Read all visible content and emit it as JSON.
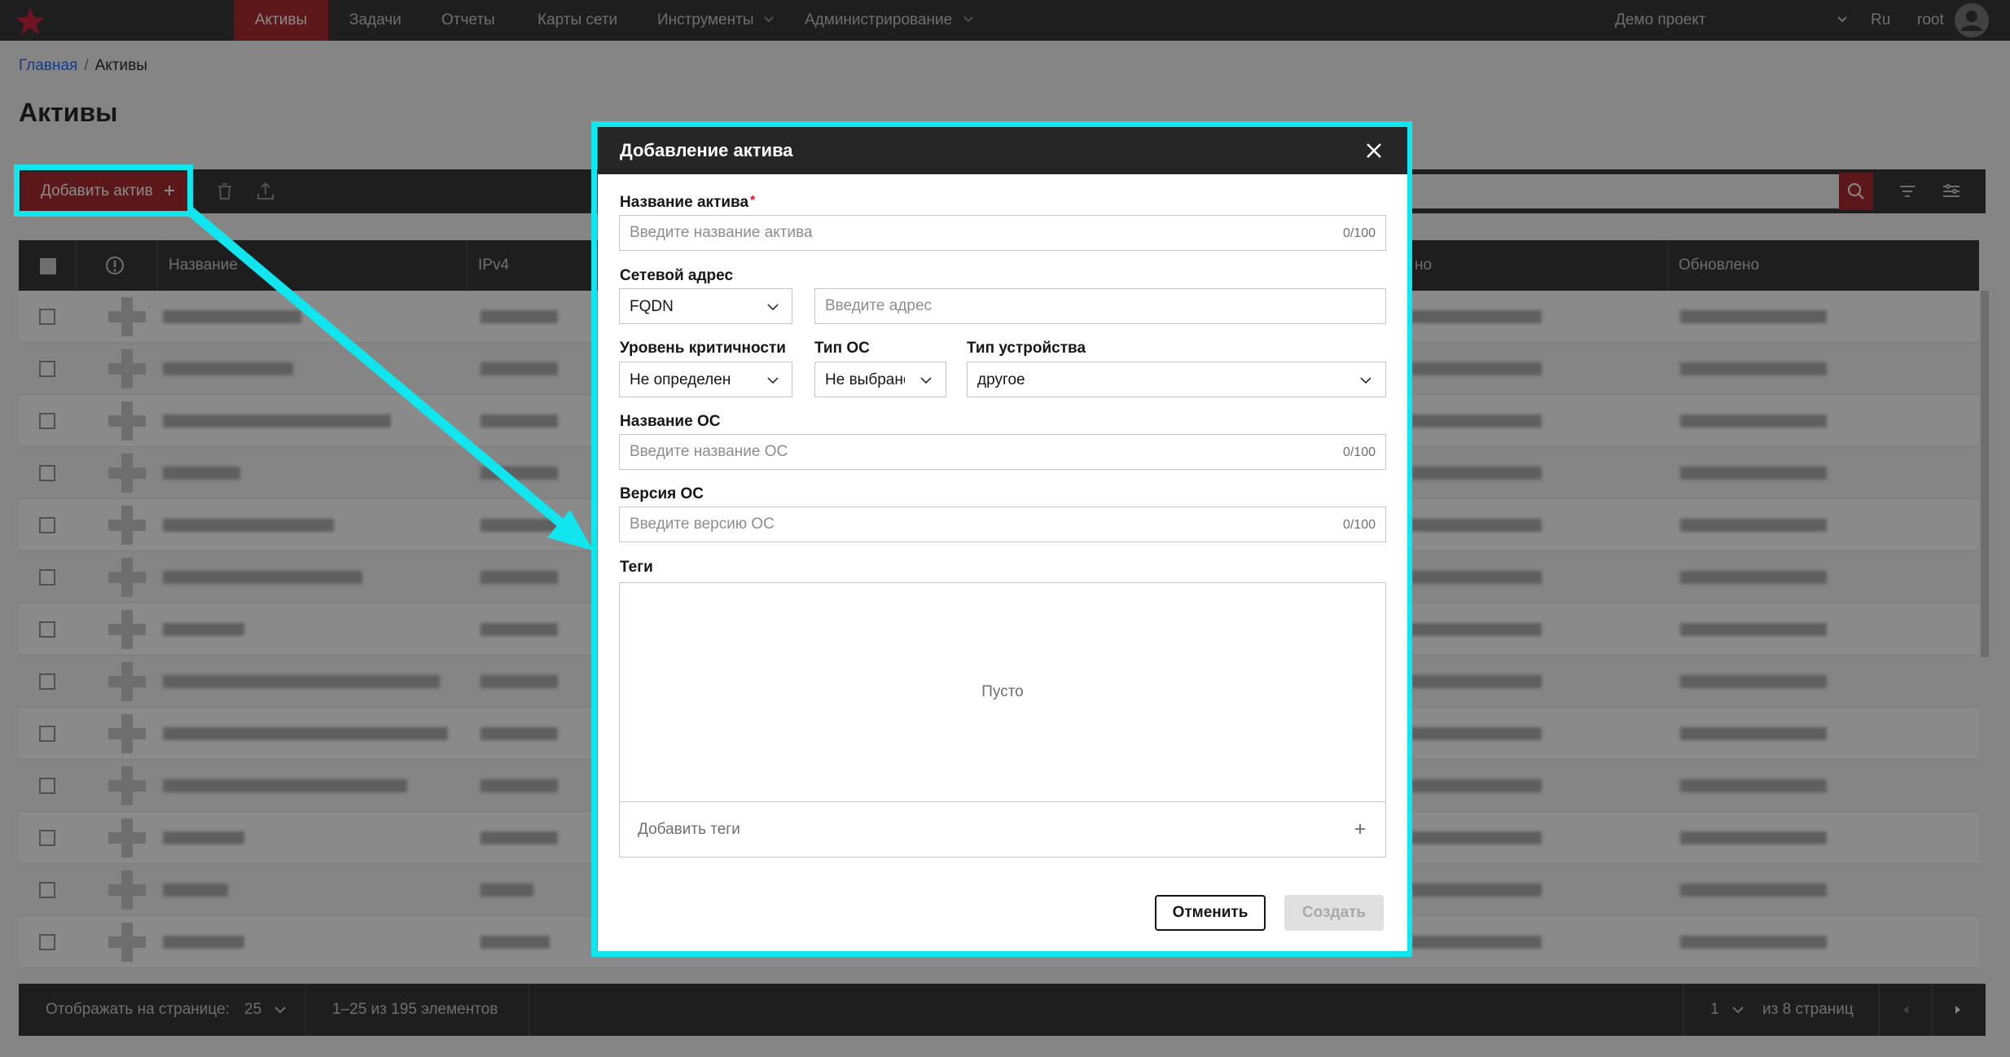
{
  "nav": {
    "items": [
      {
        "label": "Активы",
        "active": true
      },
      {
        "label": "Задачи"
      },
      {
        "label": "Отчеты"
      },
      {
        "label": "Карты сети"
      },
      {
        "label": "Инструменты"
      },
      {
        "label": "Администрирование"
      }
    ],
    "project": "Демо проект",
    "language": "Ru",
    "user": "root"
  },
  "breadcrumb": {
    "home": "Главная",
    "separator": "/",
    "current": "Активы"
  },
  "page": {
    "title": "Активы"
  },
  "toolbar": {
    "add_label": "Добавить актив"
  },
  "table": {
    "columns": [
      "Название",
      "IPv4",
      "но",
      "Обновлено"
    ],
    "row_count_visible": 13
  },
  "footer": {
    "per_page_label": "Отображать на странице:",
    "per_page_value": "25",
    "range": "1–25 из 195 элементов",
    "page_value": "1",
    "page_total": "из 8 страниц"
  },
  "modal": {
    "title": "Добавление актива",
    "asset_name": {
      "label": "Название актива",
      "required_mark": "*",
      "placeholder": "Введите название актива",
      "counter": "0/100"
    },
    "network_address": {
      "label": "Сетевой адрес",
      "type_value": "FQDN",
      "placeholder": "Введите адрес"
    },
    "criticality": {
      "label": "Уровень критичности",
      "value": "Не определен"
    },
    "os_type": {
      "label": "Тип ОС",
      "value": "Не выбрано"
    },
    "device_type": {
      "label": "Тип устройства",
      "value": "другое"
    },
    "os_name": {
      "label": "Название ОС",
      "placeholder": "Введите название ОС",
      "counter": "0/100"
    },
    "os_version": {
      "label": "Версия ОС",
      "placeholder": "Введите версию ОС",
      "counter": "0/100"
    },
    "tags": {
      "label": "Теги",
      "empty": "Пусто",
      "add_label": "Добавить теги"
    },
    "cancel_label": "Отменить",
    "create_label": "Создать"
  },
  "colors": {
    "accent": "#a2191f",
    "highlight": "#11e6ee",
    "dark": "#262626"
  }
}
